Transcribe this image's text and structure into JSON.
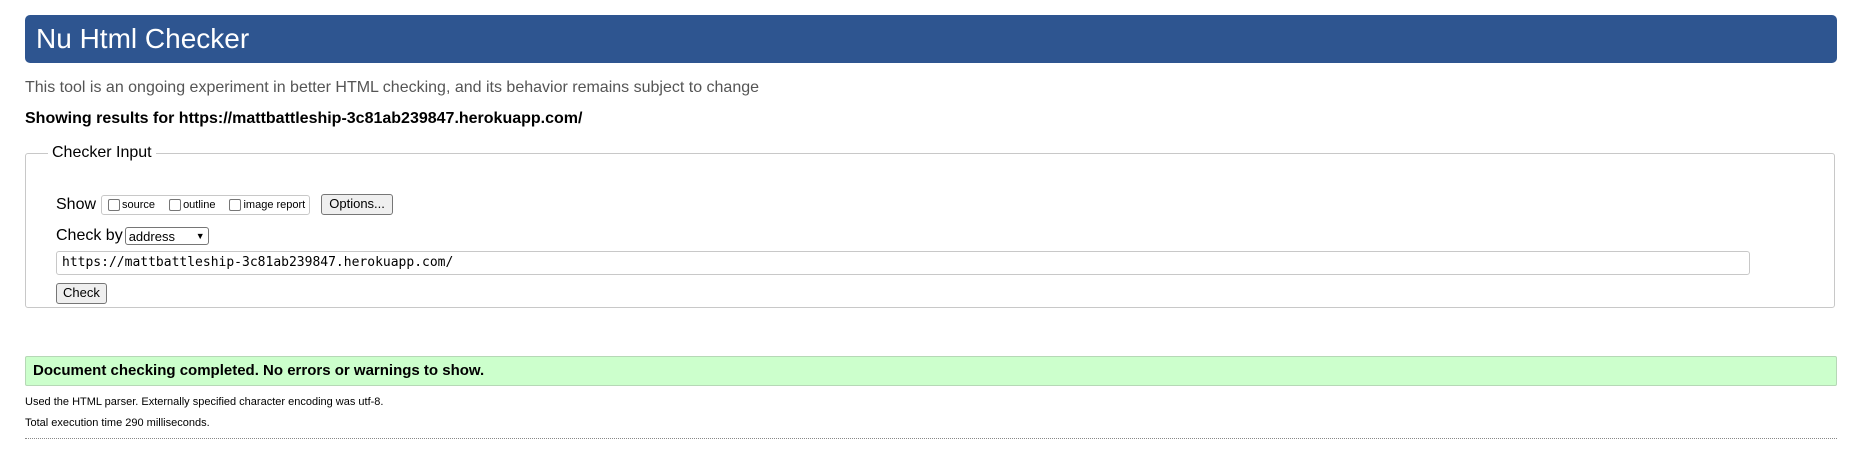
{
  "header": {
    "title": "Nu Html Checker"
  },
  "intro": "This tool is an ongoing experiment in better HTML checking, and its behavior remains subject to change",
  "showing_results": "Showing results for https://mattbattleship-3c81ab239847.herokuapp.com/",
  "checker_input": {
    "legend": "Checker Input",
    "show_label": "Show",
    "show_options": [
      {
        "label": "source",
        "checked": false
      },
      {
        "label": "outline",
        "checked": false
      },
      {
        "label": "image report",
        "checked": false
      }
    ],
    "options_button": "Options...",
    "check_by_label": "Check by",
    "check_by_selected": "address",
    "url_value": "https://mattbattleship-3c81ab239847.herokuapp.com/",
    "check_button": "Check"
  },
  "result": {
    "message": "Document checking completed. No errors or warnings to show.",
    "parser_note": "Used the HTML parser. Externally specified character encoding was utf-8.",
    "time_note": "Total execution time 290 milliseconds."
  },
  "colors": {
    "header_bg": "#2e5590",
    "success_bg": "#ccffcc"
  }
}
